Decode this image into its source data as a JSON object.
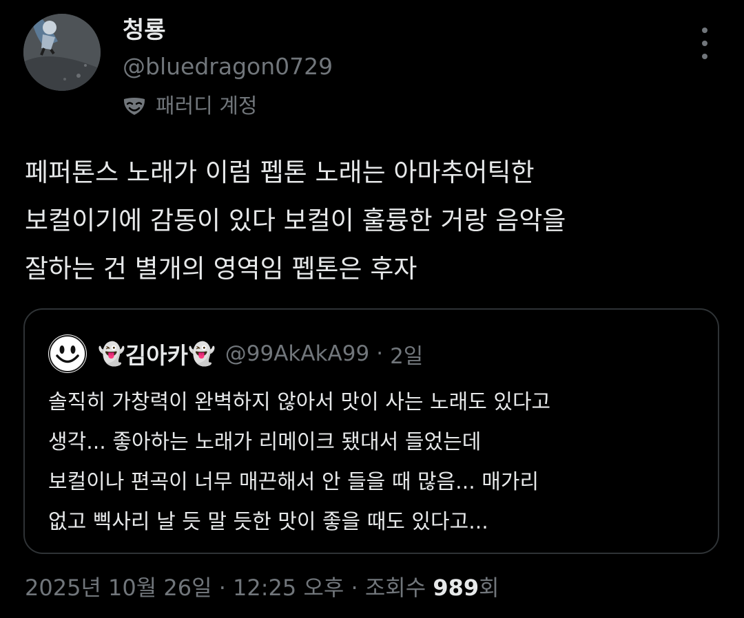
{
  "author": {
    "display_name": "청룡",
    "handle": "@bluedragon0729",
    "label_icon": "parody-mask-icon",
    "label": "패러디 계정"
  },
  "more_icon": "more-horizontal-icon",
  "tweet": {
    "lines": [
      "페퍼톤스 노래가 이럼 펩톤 노래는 아마추어틱한",
      "보컬이기에 감동이 있다 보컬이 훌륭한 거랑 음악을",
      "잘하는 건 별개의 영역임 펩톤은 후자"
    ]
  },
  "quote": {
    "avatar_icon": "smiley-face-icon",
    "ghost_icon": "👻",
    "name": "김아카",
    "handle": "@99AkAkA99",
    "separator": "·",
    "time": "2일",
    "lines": [
      "솔직히 가창력이 완벽하지 않아서 맛이 사는 노래도 있다고",
      "생각... 좋아하는 노래가 리메이크 됐대서 들었는데",
      "보컬이나 편곡이 너무 매끈해서 안 들을 때 많음... 매가리",
      "없고 삑사리 날 듯 말 듯한 맛이 좋을 때도 있다고..."
    ]
  },
  "footer": {
    "timestamp": "2025년 10월 26일 · 12:25 오후 · 조회수 ",
    "views_count": "989",
    "views_suffix": "회"
  },
  "colors": {
    "background": "#000000",
    "text_primary": "#e7e9ea",
    "text_secondary": "#71767b",
    "border": "#2f3336"
  }
}
